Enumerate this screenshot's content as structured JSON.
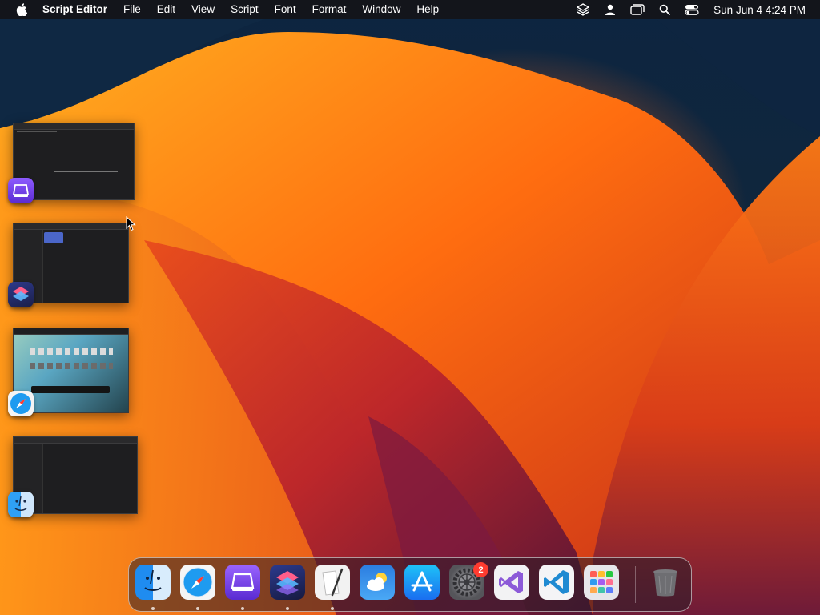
{
  "menubar": {
    "app_name": "Script Editor",
    "menus": [
      "File",
      "Edit",
      "View",
      "Script",
      "Font",
      "Format",
      "Window",
      "Help"
    ],
    "status_icons": [
      "layers-icon",
      "user-icon",
      "window-mirror-icon",
      "search-icon",
      "control-center-icon"
    ],
    "clock": "Sun Jun 4  4:24 PM"
  },
  "app_switcher": {
    "windows": [
      {
        "app": "Script Editor",
        "icon": "script-editor-icon"
      },
      {
        "app": "Shortcuts",
        "icon": "shortcuts-icon"
      },
      {
        "app": "Safari",
        "icon": "safari-icon"
      },
      {
        "app": "Finder",
        "icon": "finder-icon"
      }
    ]
  },
  "dock": {
    "apps": [
      {
        "name": "Finder",
        "icon": "finder-icon",
        "running": true
      },
      {
        "name": "Safari",
        "icon": "safari-icon",
        "running": true
      },
      {
        "name": "Script Editor",
        "icon": "script-editor-icon",
        "running": true
      },
      {
        "name": "Shortcuts",
        "icon": "shortcuts-icon",
        "running": true
      },
      {
        "name": "Script Editor",
        "icon": "pen-notes-icon",
        "running": true
      },
      {
        "name": "Weather",
        "icon": "weather-icon",
        "running": false
      },
      {
        "name": "App Store",
        "icon": "app-store-icon",
        "running": false
      },
      {
        "name": "System Settings",
        "icon": "gear-icon",
        "running": false,
        "badge": "2"
      },
      {
        "name": "Visual Studio",
        "icon": "visual-studio-icon",
        "running": false
      },
      {
        "name": "Visual Studio Code",
        "icon": "vscode-icon",
        "running": false
      },
      {
        "name": "Launchpad",
        "icon": "launchpad-icon",
        "running": false
      }
    ],
    "trash": {
      "name": "Trash",
      "icon": "trash-icon"
    }
  },
  "colors": {
    "accent_orange": "#ff6a1a",
    "badge_red": "#ff3b30",
    "menubar_bg": "#141418"
  }
}
